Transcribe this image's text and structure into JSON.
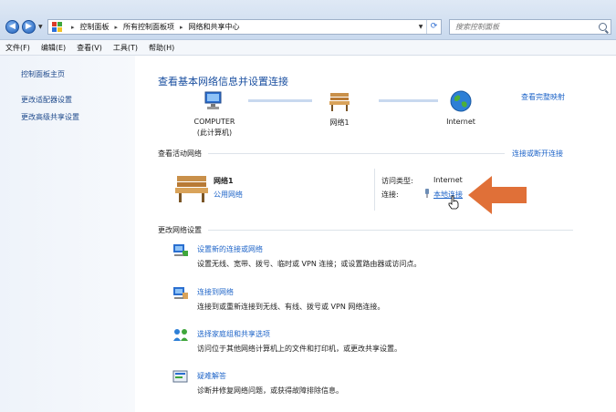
{
  "address_bar": {
    "crumbs": [
      "控制面板",
      "所有控制面板项",
      "网络和共享中心"
    ],
    "search_placeholder": "搜索控制面板"
  },
  "menu": [
    "文件(F)",
    "编辑(E)",
    "查看(V)",
    "工具(T)",
    "帮助(H)"
  ],
  "sidebar": {
    "home": "控制面板主页",
    "links": [
      "更改适配器设置",
      "更改高级共享设置"
    ]
  },
  "main": {
    "title": "查看基本网络信息并设置连接",
    "full_map_link": "查看完整映射",
    "nodes": {
      "computer": {
        "name": "COMPUTER",
        "sub": "(此计算机)"
      },
      "network": {
        "name": "网络1"
      },
      "internet": {
        "name": "Internet"
      }
    },
    "active_section": "查看活动网络",
    "connect_link": "连接或断开连接",
    "active_network": {
      "name": "网络1",
      "type_link": "公用网络"
    },
    "access_type_label": "访问类型:",
    "access_type_value": "Internet",
    "connection_label": "连接:",
    "connection_link": "本地连接",
    "change_section": "更改网络设置",
    "tasks": [
      {
        "title": "设置新的连接或网络",
        "desc": "设置无线、宽带、拨号、临时或 VPN 连接；或设置路由器或访问点。"
      },
      {
        "title": "连接到网络",
        "desc": "连接到或重新连接到无线、有线、拨号或 VPN 网络连接。"
      },
      {
        "title": "选择家庭组和共享选项",
        "desc": "访问位于其他网络计算机上的文件和打印机，或更改共享设置。"
      },
      {
        "title": "疑难解答",
        "desc": "诊断并修复网络问题，或获得故障排除信息。"
      }
    ]
  },
  "colors": {
    "link": "#1e64c8",
    "title": "#1a4fa0",
    "arrow": "#e07038"
  }
}
